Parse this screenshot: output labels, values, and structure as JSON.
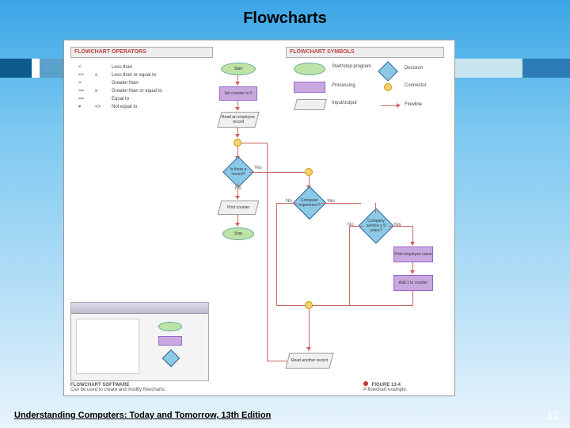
{
  "title": "Flowcharts",
  "footer": "Understanding Computers: Today and Tomorrow, 13th Edition",
  "page_number": "12",
  "panel_headers": {
    "operators": "FLOWCHART OPERATORS",
    "symbols": "FLOWCHART SYMBOLS"
  },
  "operators": [
    {
      "sym": "<",
      "alt": "",
      "desc": "Less than"
    },
    {
      "sym": "<=",
      "alt": "≤",
      "desc": "Less than or equal to"
    },
    {
      "sym": ">",
      "alt": "",
      "desc": "Greater than"
    },
    {
      "sym": ">=",
      "alt": "≥",
      "desc": "Greater than or equal to"
    },
    {
      "sym": "==",
      "alt": "",
      "desc": "Equal to"
    },
    {
      "sym": "≠",
      "alt": "<>",
      "desc": "Not equal to"
    }
  ],
  "symbols_legend": [
    {
      "label": "Start/stop program"
    },
    {
      "label": "Decision"
    },
    {
      "label": "Processing"
    },
    {
      "label": "Connector"
    },
    {
      "label": "Input/output"
    },
    {
      "label": "Flowline"
    }
  ],
  "flow": {
    "start": "Start",
    "set_counter": "Set counter to 0",
    "read_emp": "Read an employee record",
    "is_there_rec": "Is there a record?",
    "comp_exp": "Computer experience?",
    "svc_ge_5": "Company service ≥ 5 years?",
    "print_name": "Print employee name",
    "add_1": "Add 1 to counter",
    "read_another": "Read another record",
    "print_counter": "Print counter",
    "stop": "Stop",
    "yes": "Yes",
    "no": "No"
  },
  "figure_caption": {
    "num": "FIGURE 13-4",
    "text": "A flowchart example."
  },
  "software_caption": {
    "title": "FLOWCHART SOFTWARE",
    "text": "Can be used to create and modify flowcharts."
  }
}
